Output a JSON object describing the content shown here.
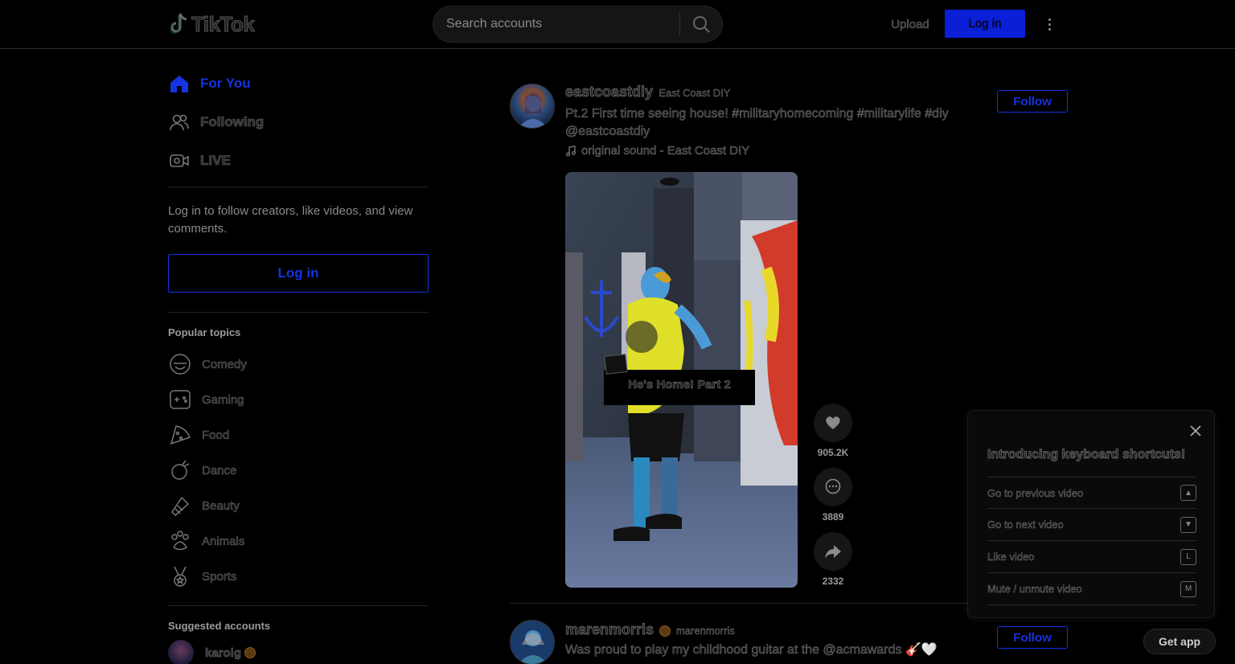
{
  "header": {
    "logo_text": "TikTok",
    "search_placeholder": "Search accounts",
    "upload_label": "Upload",
    "login_label": "Log in"
  },
  "sidebar": {
    "nav": [
      {
        "label": "For You",
        "icon": "home-icon",
        "active": true
      },
      {
        "label": "Following",
        "icon": "users-icon",
        "active": false
      },
      {
        "label": "LIVE",
        "icon": "live-camera-icon",
        "active": false
      }
    ],
    "login_blurb": "Log in to follow creators, like videos, and view comments.",
    "login_label": "Log in",
    "topics_title": "Popular topics",
    "topics": [
      {
        "label": "Comedy",
        "icon": "comedy-icon"
      },
      {
        "label": "Gaming",
        "icon": "gamepad-icon"
      },
      {
        "label": "Food",
        "icon": "pizza-icon"
      },
      {
        "label": "Dance",
        "icon": "dance-icon"
      },
      {
        "label": "Beauty",
        "icon": "lipstick-icon"
      },
      {
        "label": "Animals",
        "icon": "paw-icon"
      },
      {
        "label": "Sports",
        "icon": "medal-icon"
      }
    ],
    "suggested_title": "Suggested accounts",
    "suggested": [
      {
        "name": "karolg",
        "verified": true
      }
    ]
  },
  "posts": [
    {
      "author": "eastcoastdiy",
      "nickname": "East Coast DIY",
      "caption": "Pt.2 First time seeing house! #militaryhomecoming #militarylife #diy @eastcoastdiy",
      "sound": "original sound - East Coast DIY",
      "follow_label": "Follow",
      "video_overlay_text": "He's Home! Part 2",
      "likes": "905.2K",
      "comments": "3889",
      "shares": "2332"
    },
    {
      "author": "marenmorris",
      "nickname": "marenmorris",
      "caption": "Was proud to play my childhood guitar at the @acmawards 🎸🤍",
      "follow_label": "Follow",
      "verified": true
    }
  ],
  "shortcuts": {
    "title": "Introducing keyboard shortcuts!",
    "items": [
      {
        "label": "Go to previous video",
        "key": "▲"
      },
      {
        "label": "Go to next video",
        "key": "▼"
      },
      {
        "label": "Like video",
        "key": "L"
      },
      {
        "label": "Mute / unmute video",
        "key": "M"
      }
    ]
  },
  "get_app_label": "Get app",
  "colors": {
    "accent": "#1533e0",
    "background": "#000000"
  }
}
